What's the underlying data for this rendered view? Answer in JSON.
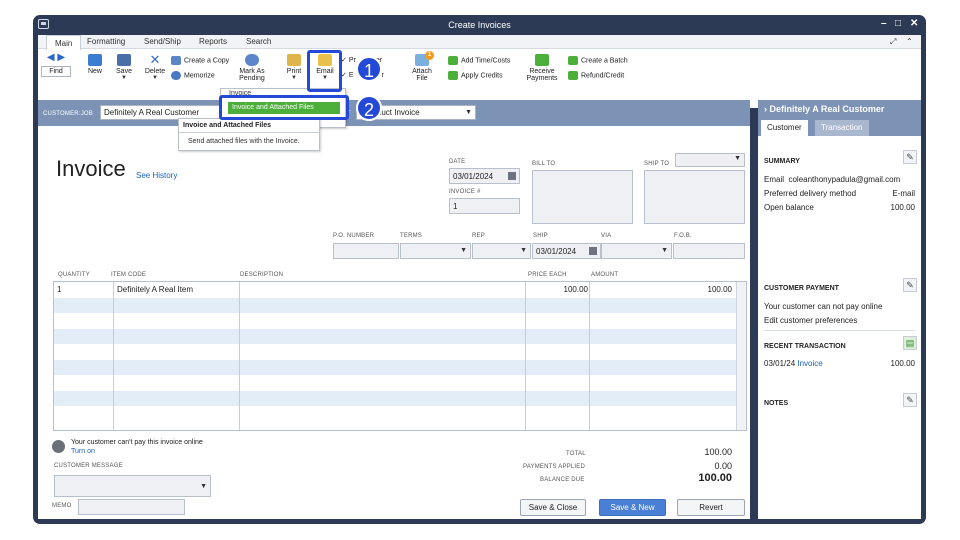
{
  "window": {
    "title": "Create Invoices"
  },
  "ribbon": {
    "tabs": [
      "Main",
      "Formatting",
      "Send/Ship",
      "Reports",
      "Search"
    ],
    "find": "Find",
    "new": "New",
    "save": "Save",
    "delete": "Delete",
    "create_copy": "Create a Copy",
    "memorize": "Memorize",
    "mark_as_pending_1": "Mark As",
    "mark_as_pending_2": "Pending",
    "print": "Print",
    "email": "Email",
    "print_later_partial": "Pr",
    "print_later_partial2": "er",
    "email_later_partial": "E",
    "email_later_partial2": "r",
    "attach_file_1": "Attach",
    "attach_file_2": "File",
    "attach_badge": "1",
    "add_time_costs": "Add Time/Costs",
    "apply_credits": "Apply Credits",
    "receive_payments_1": "Receive",
    "receive_payments_2": "Payments",
    "create_batch": "Create a Batch",
    "refund_credit": "Refund/Credit"
  },
  "email_menu": {
    "selected_item": "Invoice and Attached Files",
    "tooltip_title": "Invoice and Attached Files",
    "tooltip_text": "Send attached files with the Invoice.",
    "partial_top": "Invoice"
  },
  "customer": {
    "label": "CUSTOMER:JOB",
    "value": "Definitely A Real Customer",
    "template_label_partial": "AT",
    "template_value_partial": "t Product Invoice"
  },
  "invoice": {
    "title": "Invoice",
    "see_history": "See History",
    "date_label": "DATE",
    "date": "03/01/2024",
    "number_label": "INVOICE #",
    "number": "1",
    "bill_to_label": "BILL TO",
    "ship_to_label": "SHIP TO",
    "po_number_label": "P.O. NUMBER",
    "terms_label": "TERMS",
    "rep_label": "REP",
    "ship_label": "SHIP",
    "ship_date": "03/01/2024",
    "via_label": "VIA",
    "fob_label": "F.O.B."
  },
  "table": {
    "headers": [
      "QUANTITY",
      "ITEM CODE",
      "DESCRIPTION",
      "PRICE EACH",
      "AMOUNT"
    ],
    "rows": [
      {
        "quantity": "1",
        "item": "Definitely A Real Item",
        "description": "",
        "price": "100.00",
        "amount": "100.00"
      }
    ]
  },
  "footer": {
    "online_notice": "Your customer can't pay this invoice online",
    "turn_on": "Turn on",
    "customer_message_label": "CUSTOMER MESSAGE",
    "memo_label": "MEMO",
    "total_label": "TOTAL",
    "total": "100.00",
    "payments_applied_label": "PAYMENTS APPLIED",
    "payments_applied": "0.00",
    "balance_due_label": "BALANCE DUE",
    "balance_due": "100.00",
    "save_close": "Save & Close",
    "save_new": "Save & New",
    "revert": "Revert"
  },
  "sidebar": {
    "title": "Definitely A Real Customer",
    "tabs": [
      "Customer",
      "Transaction"
    ],
    "summary_label": "SUMMARY",
    "email_label": "Email",
    "email": "coleanthonypadula@gmail.com",
    "delivery_label": "Preferred delivery method",
    "delivery": "E-mail",
    "balance_label": "Open balance",
    "balance": "100.00",
    "payment_label": "CUSTOMER PAYMENT",
    "payment_text": "Your customer can not pay online",
    "payment_link": "Edit customer preferences",
    "recent_label": "RECENT TRANSACTION",
    "recent_date": "03/01/24",
    "recent_type": "Invoice",
    "recent_amount": "100.00",
    "notes_label": "NOTES"
  },
  "callouts": {
    "one": "1",
    "two": "2"
  },
  "colors": {
    "accent_blue": "#2349d6",
    "header_blue": "#7d93b6",
    "menu_green": "#4caf3a",
    "link": "#1a60c2"
  }
}
